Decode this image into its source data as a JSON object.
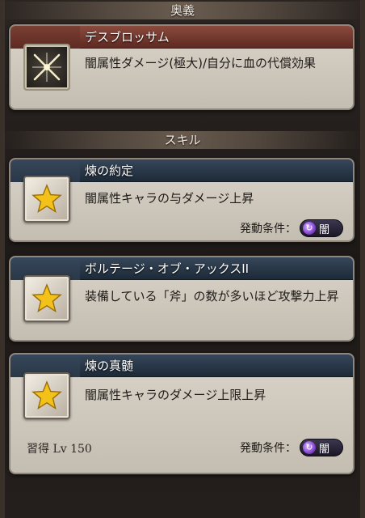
{
  "sections": {
    "ougi_header": "奥義",
    "skill_header": "スキル"
  },
  "ougi": {
    "name": "デスブロッサム",
    "description": "闇属性ダメージ(極大)/自分に血の代償効果",
    "icon": "crossed-swords-icon"
  },
  "skills": [
    {
      "name": "煉の約定",
      "description": "闇属性キャラの与ダメージ上昇",
      "icon": "star-icon",
      "condition_label": "発動条件：",
      "condition_element": "闇",
      "learn": ""
    },
    {
      "name": "ボルテージ・オブ・アックスII",
      "description": "装備している「斧」の数が多いほど攻撃力上昇",
      "icon": "star-icon",
      "condition_label": "",
      "condition_element": "",
      "learn": ""
    },
    {
      "name": "煉の真髄",
      "description": "闇属性キャラのダメージ上限上昇",
      "icon": "star-icon",
      "condition_label": "発動条件：",
      "condition_element": "闇",
      "learn": "習得 Lv 150"
    }
  ],
  "colors": {
    "ougi_bar": "#5e2a22",
    "skill_bar": "#1d2a38",
    "dark_element": "#8b4cd6",
    "star": "#f2c21a"
  }
}
